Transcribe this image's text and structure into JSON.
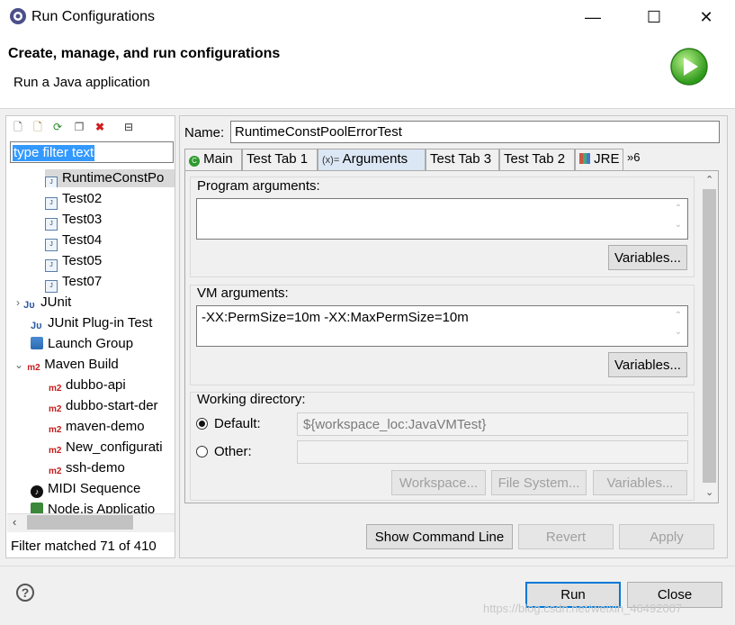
{
  "window": {
    "title": "Run Configurations",
    "minimize": "—",
    "maximize": "☐",
    "close": "✕"
  },
  "header": {
    "title": "Create, manage, and run configurations",
    "subtitle": "Run a Java application"
  },
  "left": {
    "filter_text": "type filter text",
    "tree": [
      {
        "label": "RuntimeConstPoolErrorTest",
        "display": "RuntimeConstPo",
        "icon": "junit-test-icon"
      },
      {
        "label": "Test02",
        "icon": "junit-test-icon"
      },
      {
        "label": "Test03",
        "icon": "junit-test-icon"
      },
      {
        "label": "Test04",
        "icon": "junit-test-icon"
      },
      {
        "label": "Test05",
        "icon": "junit-test-icon"
      },
      {
        "label": "Test07",
        "icon": "junit-test-icon"
      },
      {
        "label": "JUnit",
        "icon": "junit-icon"
      },
      {
        "label": "JUnit Plug-in Test",
        "icon": "junit-plugin-icon"
      },
      {
        "label": "Launch Group",
        "icon": "launch-group-icon"
      },
      {
        "label": "Maven Build",
        "icon": "maven-icon"
      },
      {
        "label": "dubbo-api",
        "icon": "maven-icon"
      },
      {
        "label": "dubbo-start-der",
        "icon": "maven-icon"
      },
      {
        "label": "maven-demo",
        "icon": "maven-icon"
      },
      {
        "label": "New_configurati",
        "icon": "maven-icon"
      },
      {
        "label": "ssh-demo",
        "icon": "maven-icon"
      },
      {
        "label": "MIDI Sequence",
        "icon": "midi-icon"
      },
      {
        "label": "Node.js Application",
        "display": "Node.js Applicatio",
        "icon": "nodejs-icon"
      }
    ],
    "status": "Filter matched 71 of 410"
  },
  "right": {
    "name_label": "Name:",
    "name_value": "RuntimeConstPoolErrorTest",
    "tabs": [
      {
        "label": "Main",
        "icon": "main-tab-icon"
      },
      {
        "label": "Test Tab 1"
      },
      {
        "label": "Arguments",
        "icon": "arguments-tab-icon",
        "active": true
      },
      {
        "label": "Test Tab 3"
      },
      {
        "label": "Test Tab 2"
      },
      {
        "label": "JRE",
        "icon": "jre-tab-icon"
      },
      {
        "label": "»6"
      }
    ],
    "program_args": {
      "label": "Program arguments:",
      "value": "",
      "variables": "Variables..."
    },
    "vm_args": {
      "label": "VM arguments:",
      "value": "-XX:PermSize=10m -XX:MaxPermSize=10m",
      "variables": "Variables..."
    },
    "working_dir": {
      "label": "Working directory:",
      "default_label": "Default:",
      "default_value": "${workspace_loc:JavaVMTest}",
      "other_label": "Other:",
      "workspace_btn": "Workspace...",
      "filesystem_btn": "File System...",
      "variables_btn": "Variables..."
    },
    "show_cmd": "Show Command Line",
    "revert": "Revert",
    "apply": "Apply"
  },
  "footer": {
    "run": "Run",
    "close": "Close",
    "help": "?"
  },
  "watermark": "https://blog.csdn.net/weixin_46492007"
}
